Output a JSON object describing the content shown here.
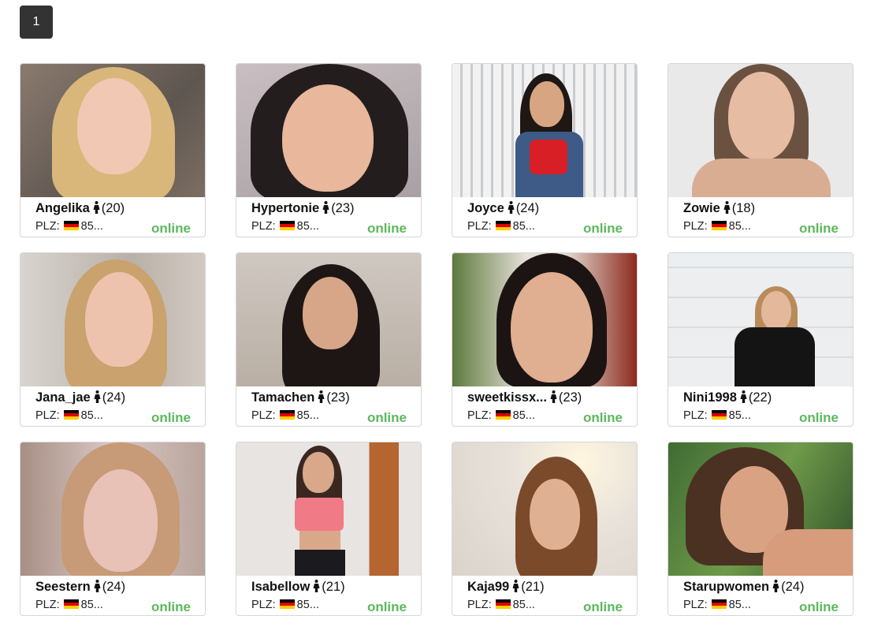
{
  "pagination": {
    "current_page": "1"
  },
  "plz_label": "PLZ:",
  "status_color": "#5cb85c",
  "gender_icon": "female-icon",
  "flag_icon": "germany-flag-icon",
  "profiles": [
    {
      "name": "Angelika",
      "age": "(20)",
      "plz": "85...",
      "status": "online"
    },
    {
      "name": "Hypertonie",
      "age": "(23)",
      "plz": "85...",
      "status": "online"
    },
    {
      "name": "Joyce",
      "age": "(24)",
      "plz": "85...",
      "status": "online"
    },
    {
      "name": "Zowie",
      "age": "(18)",
      "plz": "85...",
      "status": "online"
    },
    {
      "name": "Jana_jae",
      "age": "(24)",
      "plz": "85...",
      "status": "online"
    },
    {
      "name": "Tamachen",
      "age": "(23)",
      "plz": "85...",
      "status": "online"
    },
    {
      "name": "sweetkissx...",
      "age": "(23)",
      "plz": "85...",
      "status": "online"
    },
    {
      "name": "Nini1998",
      "age": "(22)",
      "plz": "85...",
      "status": "online"
    },
    {
      "name": "Seestern",
      "age": "(24)",
      "plz": "85...",
      "status": "online"
    },
    {
      "name": "Isabellow",
      "age": "(21)",
      "plz": "85...",
      "status": "online"
    },
    {
      "name": "Kaja99",
      "age": "(21)",
      "plz": "85...",
      "status": "online"
    },
    {
      "name": "Starupwomen",
      "age": "(24)",
      "plz": "85...",
      "status": "online"
    }
  ]
}
